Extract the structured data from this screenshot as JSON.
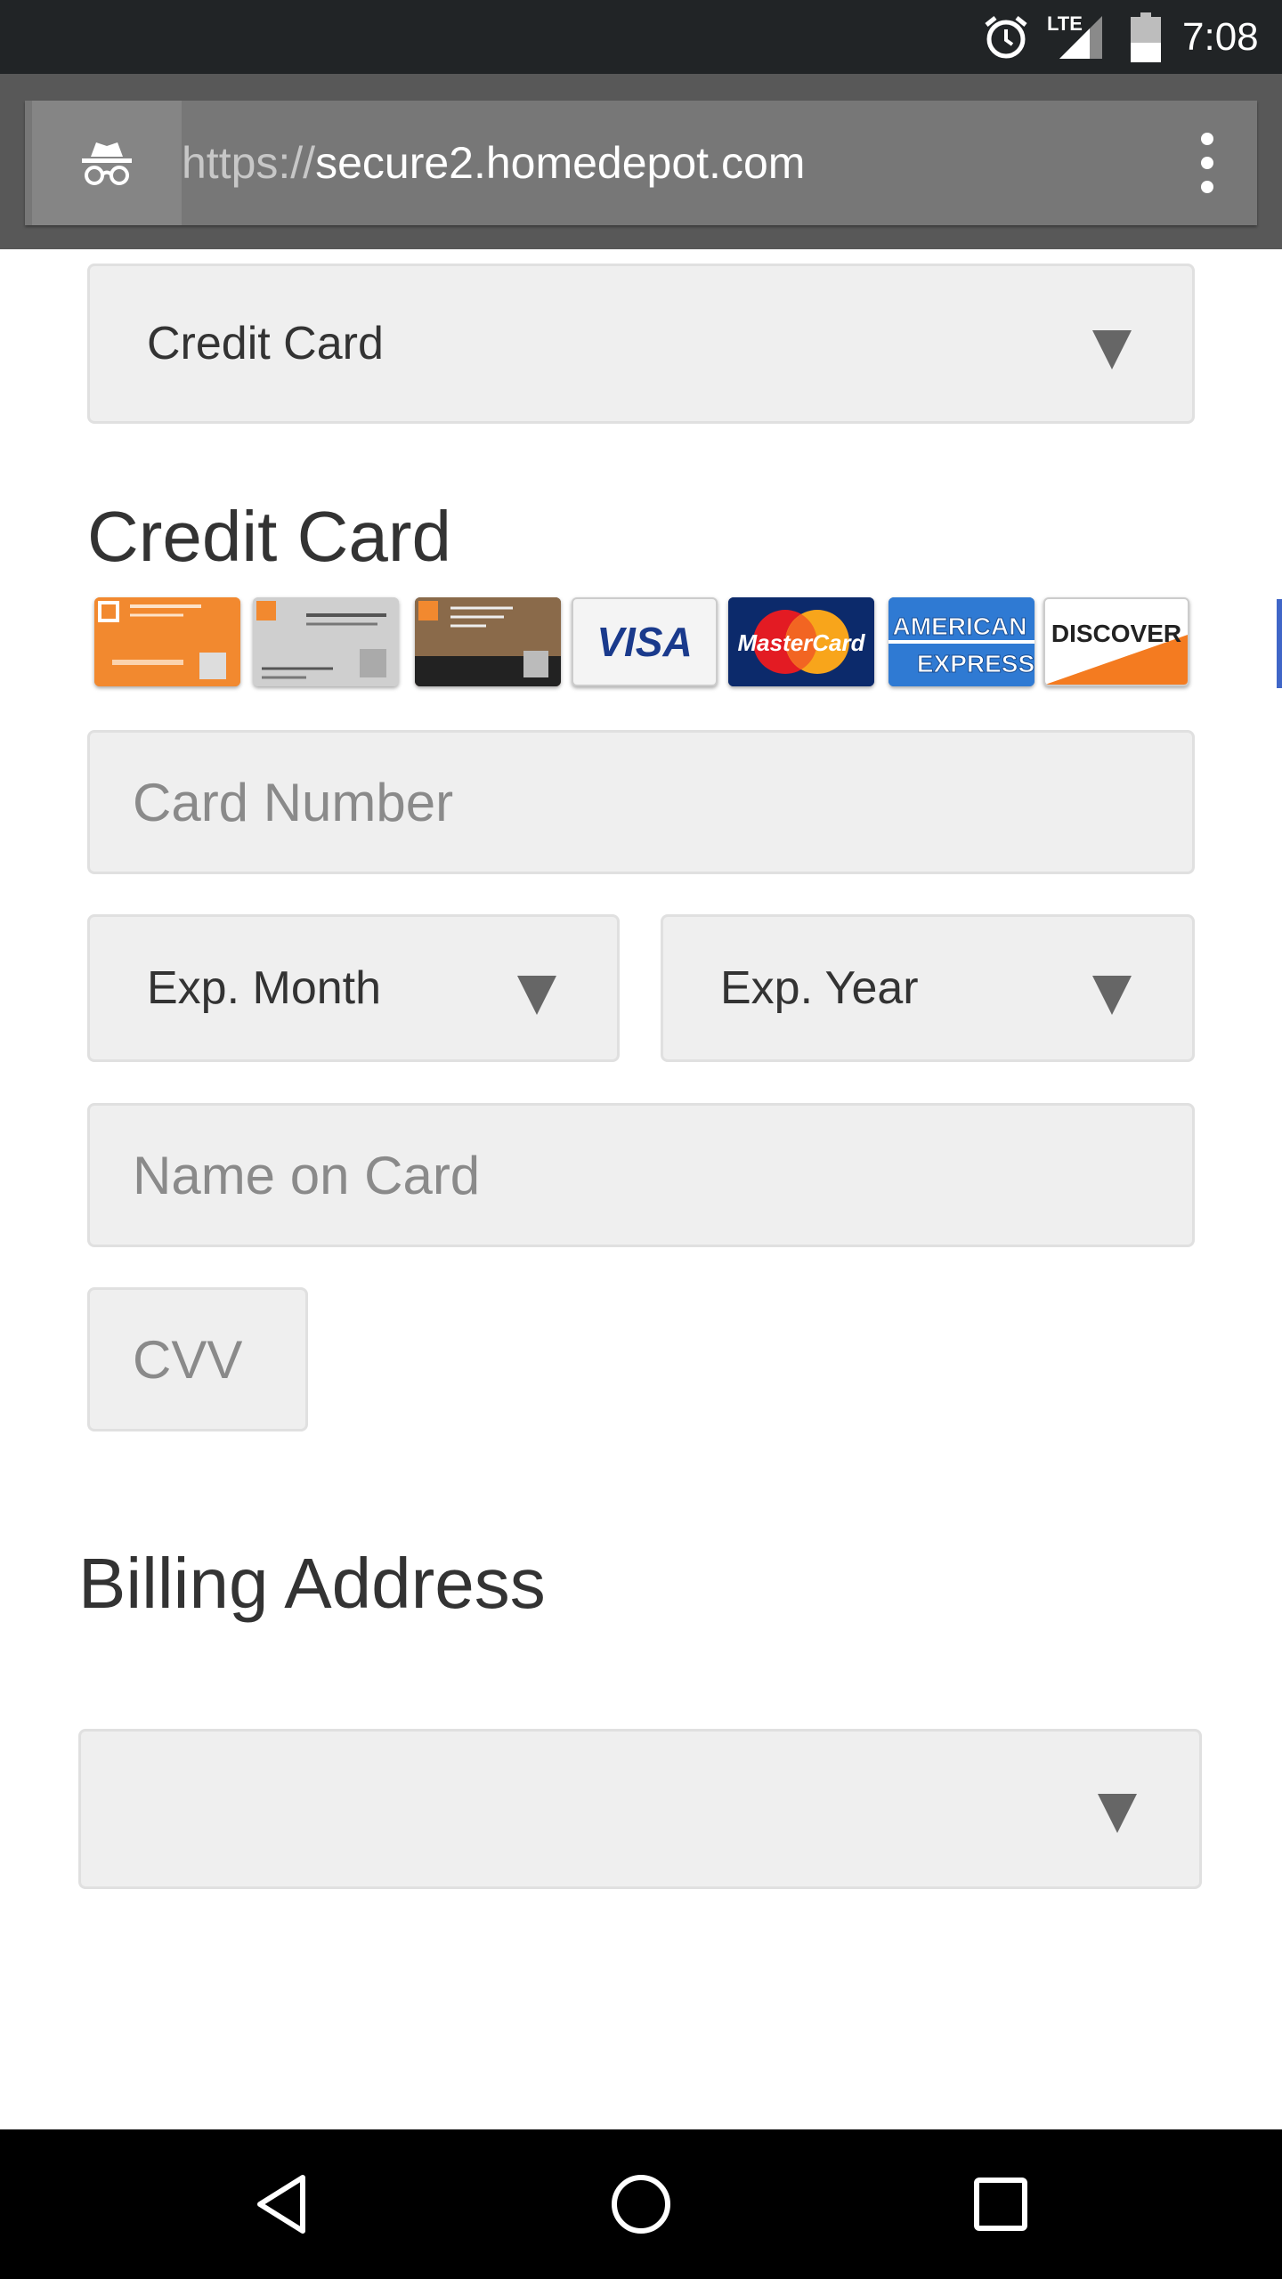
{
  "status_bar": {
    "time": "7:08",
    "network": "LTE",
    "icons": [
      "alarm-icon",
      "lte-signal-icon",
      "battery-icon"
    ]
  },
  "browser": {
    "url_scheme": "https://",
    "url_host": "secure2.homedepot.com",
    "mode": "incognito"
  },
  "payment": {
    "method_select": "Credit Card",
    "heading": "Credit Card",
    "accepted_cards": [
      "Home Depot Consumer Card",
      "Commercial Account",
      "Commercial Revolving Charge",
      "VISA",
      "MasterCard",
      "AMERICAN EXPRESS",
      "DISCOVER"
    ],
    "card_number_placeholder": "Card Number",
    "exp_month": "Exp. Month",
    "exp_year": "Exp. Year",
    "name_placeholder": "Name on Card",
    "cvv_placeholder": "CVV"
  },
  "billing": {
    "heading": "Billing Address",
    "address_select": ""
  },
  "colors": {
    "status_bar": "#212426",
    "toolbar": "#585858",
    "field_bg": "#efefef",
    "text": "#333333",
    "placeholder": "#8a8a8a"
  },
  "nav": {
    "buttons": [
      "back-icon",
      "home-icon",
      "recents-icon"
    ]
  }
}
